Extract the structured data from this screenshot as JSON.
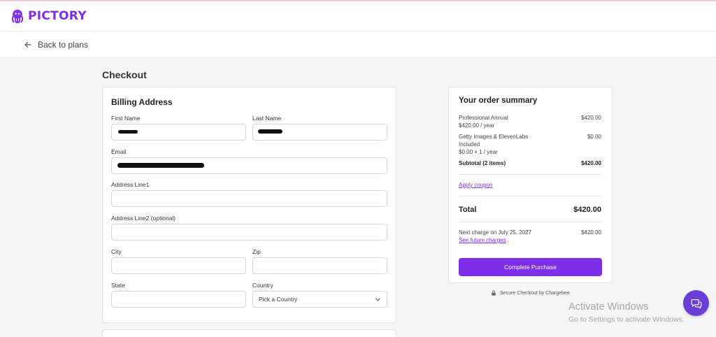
{
  "brand": {
    "name": "PICTORY",
    "color": "#7c2ee8"
  },
  "nav": {
    "back_label": "Back to plans"
  },
  "page": {
    "title": "Checkout"
  },
  "billing": {
    "title": "Billing Address",
    "fields": {
      "first_name": {
        "label": "First Name",
        "value": ""
      },
      "last_name": {
        "label": "Last Name",
        "value": ""
      },
      "email": {
        "label": "Email",
        "value": ""
      },
      "address1": {
        "label": "Address Line1",
        "value": ""
      },
      "address2": {
        "label": "Address Line2 (optional)",
        "value": ""
      },
      "city": {
        "label": "City",
        "value": ""
      },
      "zip": {
        "label": "Zip",
        "value": ""
      },
      "state": {
        "label": "State",
        "value": ""
      },
      "country": {
        "label": "Country",
        "selected": "Pick a Country"
      }
    }
  },
  "summary": {
    "title": "Your order summary",
    "items": [
      {
        "name": "Professional Annual",
        "detail": "$420.00 / year",
        "amount": "$420.00"
      },
      {
        "name": "Getty Images & ElevenLabs",
        "name2": "Included",
        "detail": "$0.00 × 1 / year",
        "amount": "$0.00"
      }
    ],
    "subtotal_label": "Subtotal (2 items)",
    "subtotal_amount": "$420.00",
    "coupon_label": "Apply coupon",
    "total_label": "Total",
    "total_amount": "$420.00",
    "next_charge_label": "Next charge on July 25, 2027",
    "next_charge_amount": "$420.00",
    "future_charges_label": "See future charges",
    "purchase_button": "Complete Purchase"
  },
  "secure_note": "Secure Checkout by Chargebee",
  "windows_notice": {
    "title": "Activate Windows",
    "subtitle": "Go to Settings to activate Windows."
  },
  "colors": {
    "accent": "#7c2ee8",
    "chat": "#6a3fd6"
  }
}
